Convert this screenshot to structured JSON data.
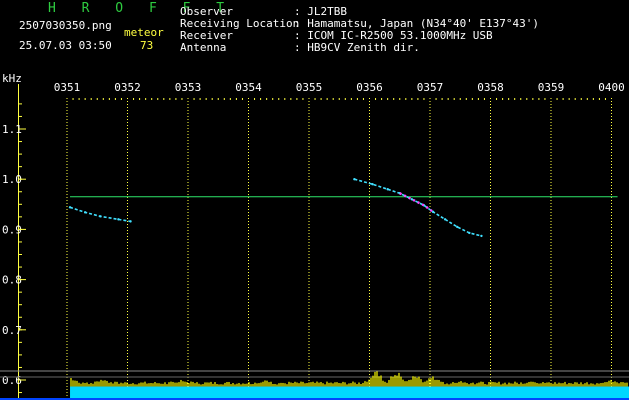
{
  "header": {
    "logo": "H R O F F T",
    "filename": "2507030350.png",
    "datetime": "25.07.03 03:50",
    "event_label": "meteor",
    "event_count": "73",
    "info_labels": [
      "Observer",
      "Receiving Location",
      "Receiver",
      "Antenna"
    ],
    "info_values": [
      ": JL2TBB",
      ": Hamamatsu, Japan (N34°40' E137°43')",
      ": ICOM IC-R2500 53.1000MHz USB",
      ": HB9CV Zenith dir."
    ]
  },
  "colors": {
    "background": "#000000",
    "text_white": "#ffffff",
    "text_yellow": "#ffff40",
    "logo_green": "#2ecc40",
    "reference_line": "#2ee66b",
    "trail": "#40e0ff",
    "trail_core": "#ff40ff",
    "level_cyan": "#00d8ff",
    "level_yellow": "#ffff00",
    "grid_tick": "#ffff40"
  },
  "chart_data": {
    "type": "scatter",
    "title": "",
    "ylabel": "kHz",
    "x_ticks": [
      "0351",
      "0352",
      "0353",
      "0354",
      "0355",
      "0356",
      "0357",
      "0358",
      "0359",
      "0400"
    ],
    "x_range_minutes": [
      0,
      9
    ],
    "y_ticks": [
      1.1,
      1.0,
      0.9,
      0.8,
      0.7,
      0.6
    ],
    "y_range_khz": [
      0.58,
      1.16
    ],
    "reference_line_khz": 0.965,
    "reference_span_minutes": [
      0.05,
      9.1
    ],
    "series": [
      {
        "x_min": [
          4.75,
          5.05,
          5.3,
          5.5,
          5.7,
          5.9,
          6.05,
          6.25,
          6.45,
          6.65,
          6.85
        ],
        "y_khz": [
          1.0,
          0.99,
          0.98,
          0.972,
          0.96,
          0.948,
          0.935,
          0.92,
          0.905,
          0.893,
          0.887
        ]
      },
      {
        "x_min": [
          0.05,
          0.3,
          0.55,
          0.85,
          1.05
        ],
        "y_khz": [
          0.944,
          0.934,
          0.926,
          0.92,
          0.916
        ]
      }
    ],
    "bright_core_x_minutes": [
      5.4,
      6.1
    ],
    "level_band": {
      "x_start_minutes": 0.05,
      "base_level_khz": 0.587,
      "peaks": [
        {
          "x_minutes": 0.05,
          "height_khz": 0.022
        },
        {
          "x_minutes": 0.6,
          "height_khz": 0.018
        },
        {
          "x_minutes": 1.9,
          "height_khz": 0.016
        },
        {
          "x_minutes": 3.3,
          "height_khz": 0.014
        },
        {
          "x_minutes": 5.1,
          "height_khz": 0.036
        },
        {
          "x_minutes": 5.45,
          "height_khz": 0.034
        },
        {
          "x_minutes": 5.75,
          "height_khz": 0.028
        },
        {
          "x_minutes": 6.05,
          "height_khz": 0.024
        },
        {
          "x_minutes": 6.5,
          "height_khz": 0.014
        },
        {
          "x_minutes": 7.7,
          "height_khz": 0.015
        },
        {
          "x_minutes": 9.0,
          "height_khz": 0.014
        }
      ]
    }
  }
}
